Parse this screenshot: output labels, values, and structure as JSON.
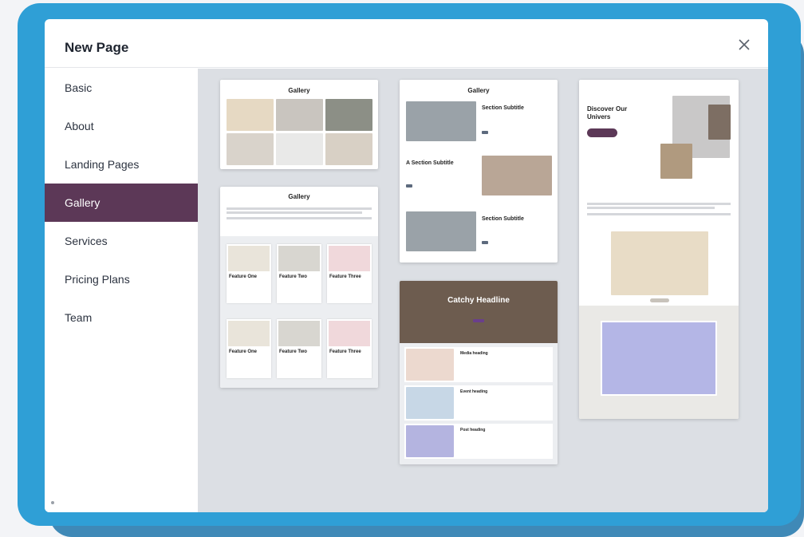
{
  "dialog": {
    "title": "New Page",
    "close_icon": "close-icon"
  },
  "sidebar": {
    "items": [
      {
        "label": "Basic",
        "active": false
      },
      {
        "label": "About",
        "active": false
      },
      {
        "label": "Landing Pages",
        "active": false
      },
      {
        "label": "Gallery",
        "active": true
      },
      {
        "label": "Services",
        "active": false
      },
      {
        "label": "Pricing Plans",
        "active": false
      },
      {
        "label": "Team",
        "active": false
      }
    ]
  },
  "templates": {
    "gallery_grid": {
      "title": "Gallery"
    },
    "gallery_features": {
      "title": "Gallery",
      "features": [
        "Feature One",
        "Feature Two",
        "Feature Three",
        "Feature One",
        "Feature Two",
        "Feature Three"
      ]
    },
    "gallery_sections": {
      "title": "Gallery",
      "section1": "Section Subtitle",
      "section2": "A Section Subtitle",
      "section3": "Section Subtitle"
    },
    "catchy": {
      "headline": "Catchy Headline",
      "media": "Media heading",
      "event": "Event heading",
      "post": "Post heading"
    },
    "discover": {
      "heading": "Discover Our Univers"
    }
  },
  "colors": {
    "accent": "#5c3857",
    "frame": "#2f9fd6",
    "canvas": "#dcdfe4"
  }
}
